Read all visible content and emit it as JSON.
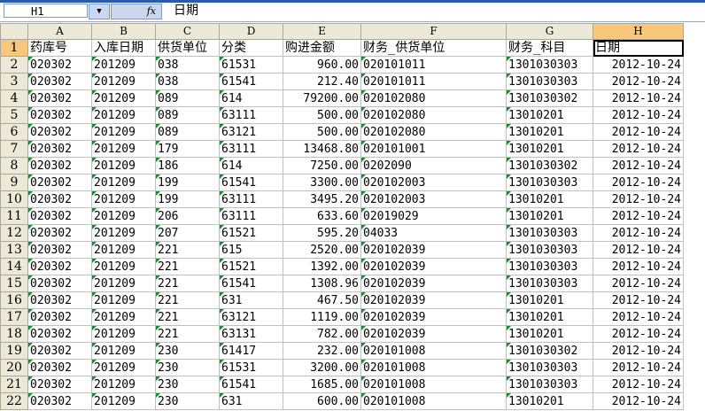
{
  "formula_bar": {
    "cell_ref": "H1",
    "dropdown_glyph": "▼",
    "fx_label": "fx",
    "formula": "日期"
  },
  "columns": [
    "A",
    "B",
    "C",
    "D",
    "E",
    "F",
    "G",
    "H"
  ],
  "header_row": [
    "药库号",
    "入库日期",
    "供货单位",
    "分类",
    "购进金额",
    "财务_供货单位",
    "财务_科目",
    "日期"
  ],
  "rows": [
    [
      "020302",
      "201209",
      "038",
      "61531",
      "960.00",
      "020101011",
      "1301030303",
      "2012-10-24"
    ],
    [
      "020302",
      "201209",
      "038",
      "61541",
      "212.40",
      "020101011",
      "1301030303",
      "2012-10-24"
    ],
    [
      "020302",
      "201209",
      "089",
      "614",
      "79200.00",
      "020102080",
      "1301030302",
      "2012-10-24"
    ],
    [
      "020302",
      "201209",
      "089",
      "63111",
      "500.00",
      "020102080",
      "13010201",
      "2012-10-24"
    ],
    [
      "020302",
      "201209",
      "089",
      "63121",
      "500.00",
      "020102080",
      "13010201",
      "2012-10-24"
    ],
    [
      "020302",
      "201209",
      "179",
      "63111",
      "13468.80",
      "020101001",
      "13010201",
      "2012-10-24"
    ],
    [
      "020302",
      "201209",
      "186",
      "614",
      "7250.00",
      "0202090",
      "1301030302",
      "2012-10-24"
    ],
    [
      "020302",
      "201209",
      "199",
      "61541",
      "3300.00",
      "020102003",
      "1301030303",
      "2012-10-24"
    ],
    [
      "020302",
      "201209",
      "199",
      "63111",
      "3495.20",
      "020102003",
      "13010201",
      "2012-10-24"
    ],
    [
      "020302",
      "201209",
      "206",
      "63111",
      "633.60",
      "02019029",
      "13010201",
      "2012-10-24"
    ],
    [
      "020302",
      "201209",
      "207",
      "61521",
      "595.20",
      "04033",
      "1301030303",
      "2012-10-24"
    ],
    [
      "020302",
      "201209",
      "221",
      "615",
      "2520.00",
      "020102039",
      "1301030303",
      "2012-10-24"
    ],
    [
      "020302",
      "201209",
      "221",
      "61521",
      "1392.00",
      "020102039",
      "1301030303",
      "2012-10-24"
    ],
    [
      "020302",
      "201209",
      "221",
      "61541",
      "1308.96",
      "020102039",
      "1301030303",
      "2012-10-24"
    ],
    [
      "020302",
      "201209",
      "221",
      "631",
      "467.50",
      "020102039",
      "13010201",
      "2012-10-24"
    ],
    [
      "020302",
      "201209",
      "221",
      "63121",
      "1119.00",
      "020102039",
      "13010201",
      "2012-10-24"
    ],
    [
      "020302",
      "201209",
      "221",
      "63131",
      "782.00",
      "020102039",
      "13010201",
      "2012-10-24"
    ],
    [
      "020302",
      "201209",
      "230",
      "61417",
      "232.00",
      "020101008",
      "1301030302",
      "2012-10-24"
    ],
    [
      "020302",
      "201209",
      "230",
      "61531",
      "3200.00",
      "020101008",
      "1301030303",
      "2012-10-24"
    ],
    [
      "020302",
      "201209",
      "230",
      "61541",
      "1685.00",
      "020101008",
      "1301030303",
      "2012-10-24"
    ],
    [
      "020302",
      "201209",
      "230",
      "631",
      "600.00",
      "020101008",
      "13010201",
      "2012-10-24"
    ]
  ],
  "colors": {
    "selected_header": "#f9c77c",
    "header_bg": "#ece9d8",
    "grid": "#c0c0c0",
    "error_triangle": "#1c8a2c"
  }
}
